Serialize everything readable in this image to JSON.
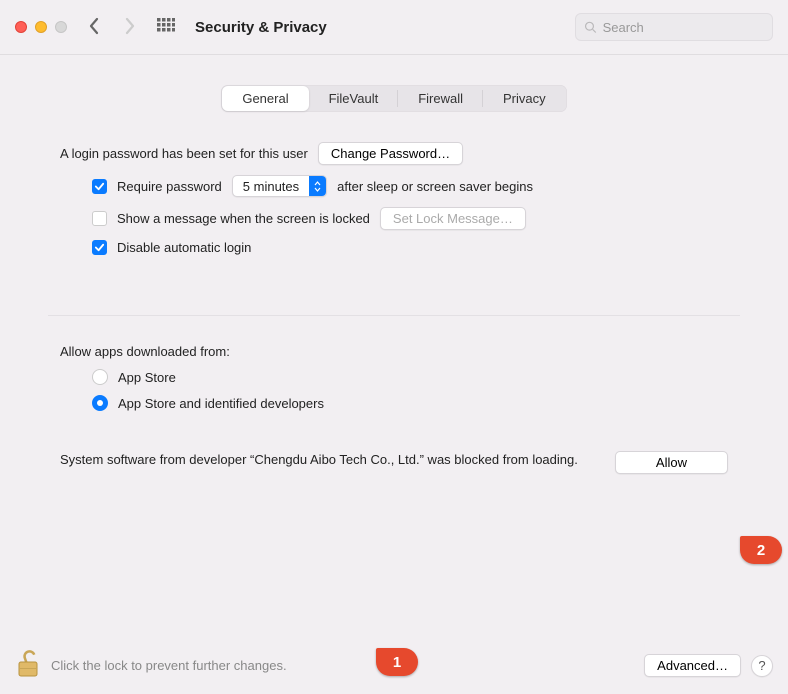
{
  "window": {
    "title": "Security & Privacy",
    "search_placeholder": "Search"
  },
  "tabs": {
    "general": "General",
    "filevault": "FileVault",
    "firewall": "Firewall",
    "privacy": "Privacy"
  },
  "general": {
    "login_pw_text": "A login password has been set for this user",
    "change_pw_btn": "Change Password…",
    "require_pw_label": "Require password",
    "require_pw_select": "5 minutes",
    "require_pw_after": "after sleep or screen saver begins",
    "show_message_label": "Show a message when the screen is locked",
    "set_lock_msg_btn": "Set Lock Message…",
    "disable_auto_login": "Disable automatic login",
    "allow_apps_label": "Allow apps downloaded from:",
    "radio_appstore": "App Store",
    "radio_identified": "App Store and identified developers",
    "blocked_text": "System software from developer “Chengdu Aibo Tech Co., Ltd.” was blocked from loading.",
    "allow_btn": "Allow"
  },
  "footer": {
    "lock_text": "Click the lock to prevent further changes.",
    "advanced_btn": "Advanced…",
    "help": "?"
  },
  "markers": {
    "one": "1",
    "two": "2"
  }
}
